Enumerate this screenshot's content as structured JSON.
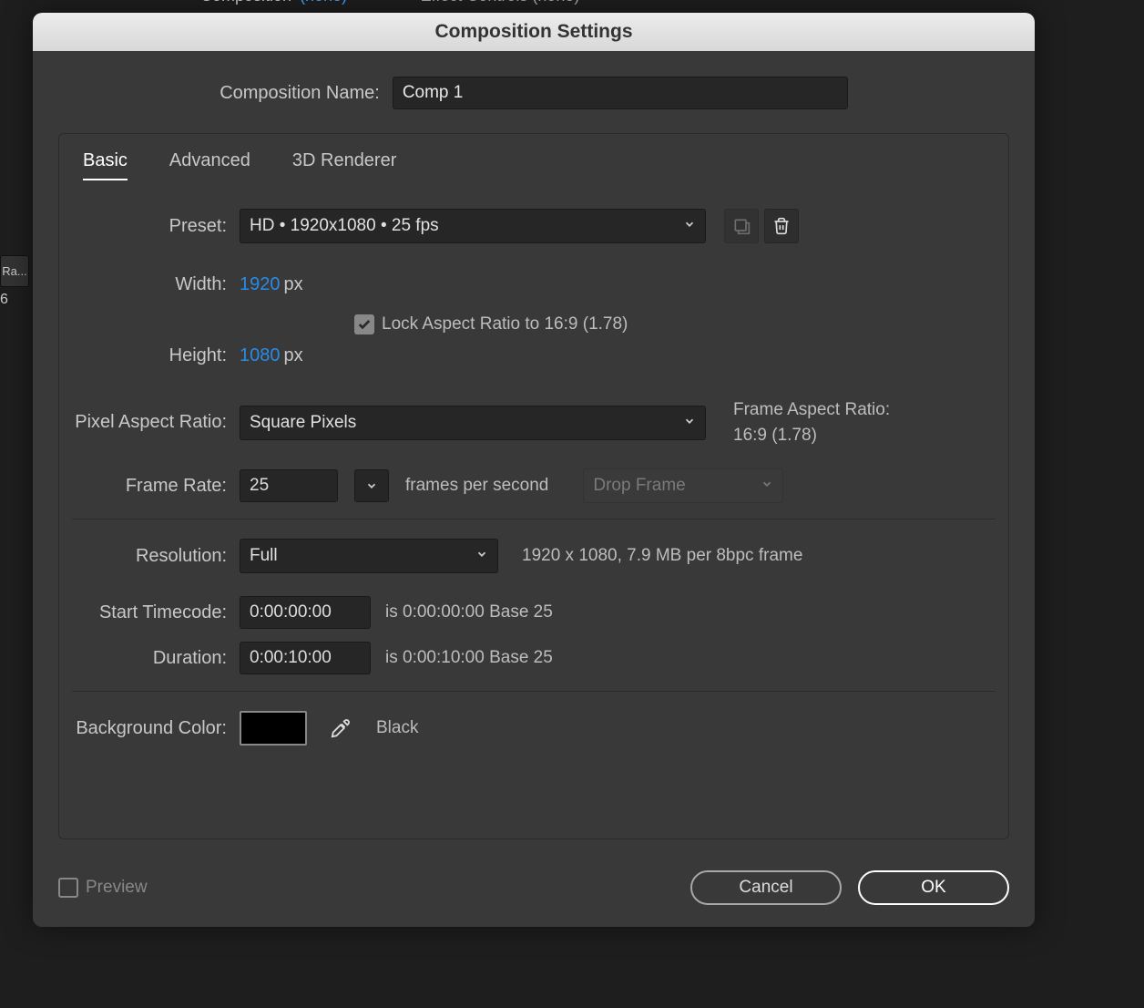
{
  "bg": {
    "top_text_1": "Composition",
    "top_text_2": "(none)",
    "top_text_3": "Effect Controls (none)",
    "side1": "Ra...",
    "side2": "6"
  },
  "dialog": {
    "title": "Composition Settings",
    "comp_name_label": "Composition Name:",
    "comp_name_value": "Comp 1",
    "tabs": {
      "basic": "Basic",
      "advanced": "Advanced",
      "renderer": "3D Renderer"
    },
    "preset": {
      "label": "Preset:",
      "value": "HD  •  1920x1080 • 25 fps"
    },
    "width": {
      "label": "Width:",
      "value": "1920",
      "unit": "px"
    },
    "height": {
      "label": "Height:",
      "value": "1080",
      "unit": "px"
    },
    "lock_aspect": "Lock Aspect Ratio to 16:9 (1.78)",
    "par": {
      "label": "Pixel Aspect Ratio:",
      "value": "Square Pixels"
    },
    "frame_aspect": {
      "label": "Frame Aspect Ratio:",
      "value": "16:9 (1.78)"
    },
    "frame_rate": {
      "label": "Frame Rate:",
      "value": "25",
      "suffix": "frames per second",
      "drop_label": "Drop Frame"
    },
    "resolution": {
      "label": "Resolution:",
      "value": "Full",
      "info": "1920 x 1080, 7.9 MB per 8bpc frame"
    },
    "start_tc": {
      "label": "Start Timecode:",
      "value": "0:00:00:00",
      "info": "is 0:00:00:00  Base 25"
    },
    "duration": {
      "label": "Duration:",
      "value": "0:00:10:00",
      "info": "is 0:00:10:00  Base 25"
    },
    "bg_color": {
      "label": "Background Color:",
      "name": "Black",
      "hex": "#000000"
    },
    "preview": "Preview",
    "cancel": "Cancel",
    "ok": "OK"
  }
}
